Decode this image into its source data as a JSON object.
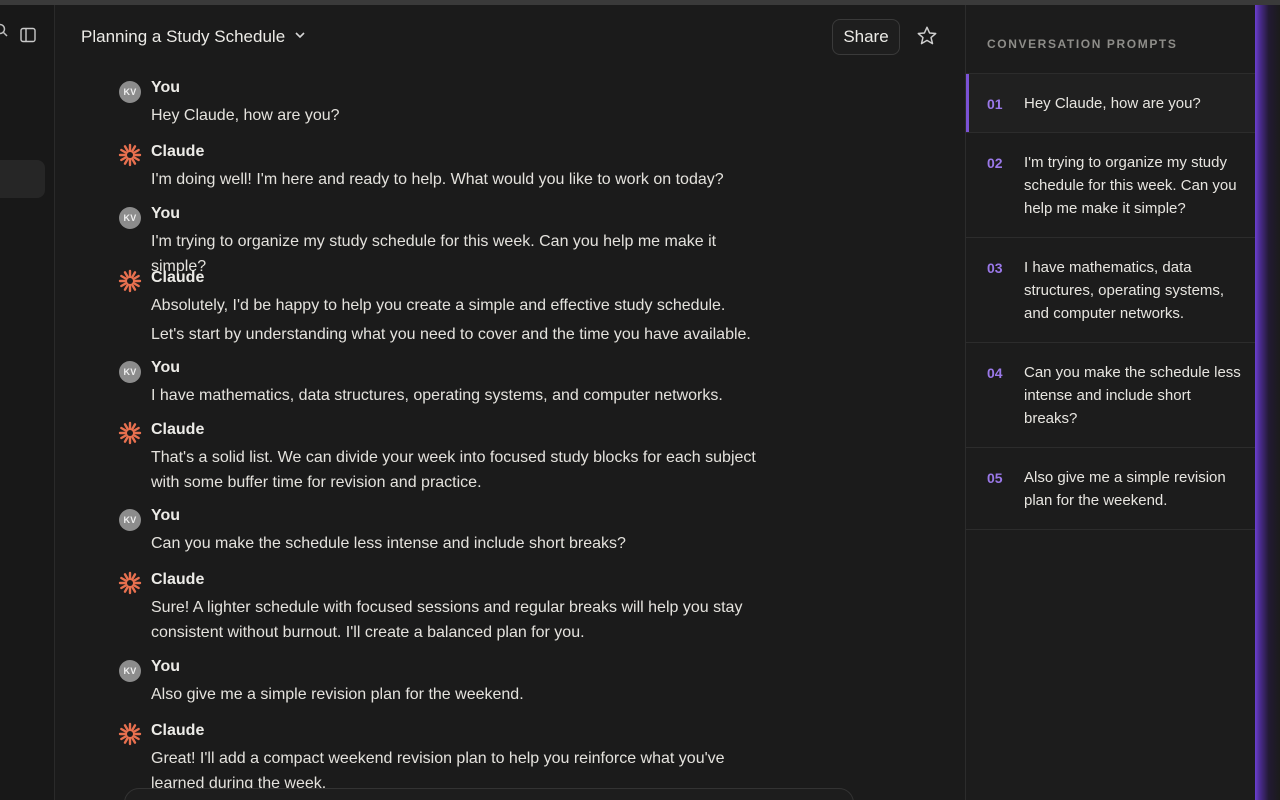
{
  "header": {
    "title": "Planning a Study Schedule",
    "share_label": "Share"
  },
  "colors": {
    "background": "#1b1b1b",
    "accent_purple": "#7b52d6",
    "claude_orange": "#e8704f",
    "avatar_gray": "#8c8c8c"
  },
  "messages": [
    {
      "sender": "You",
      "avatar": "KV",
      "text": [
        "Hey Claude, how are you?"
      ]
    },
    {
      "sender": "Claude",
      "text": [
        "I'm doing well! I'm here and ready to help. What would you like to work on today?"
      ]
    },
    {
      "sender": "You",
      "avatar": "KV",
      "text": [
        "I'm trying to organize my study schedule for this week. Can you help me make it simple?"
      ]
    },
    {
      "sender": "Claude",
      "text": [
        "Absolutely, I'd be happy to help you create a simple and effective study schedule.",
        "Let's start by understanding what you need to cover and the time you have available."
      ]
    },
    {
      "sender": "You",
      "avatar": "KV",
      "text": [
        "I have mathematics, data structures, operating systems, and computer networks."
      ]
    },
    {
      "sender": "Claude",
      "text": [
        "That's a solid list. We can divide your week into focused study blocks for each subject with some buffer time for revision and practice."
      ]
    },
    {
      "sender": "You",
      "avatar": "KV",
      "text": [
        "Can you make the schedule less intense and include short breaks?"
      ]
    },
    {
      "sender": "Claude",
      "text": [
        "Sure! A lighter schedule with focused sessions and regular breaks will help you stay consistent without burnout. I'll create a balanced plan for you."
      ]
    },
    {
      "sender": "You",
      "avatar": "KV",
      "text": [
        "Also give me a simple revision plan for the weekend."
      ]
    },
    {
      "sender": "Claude",
      "text": [
        "Great! I'll add a compact weekend revision plan to help you reinforce what you've learned during the week."
      ]
    }
  ],
  "panel": {
    "heading": "CONVERSATION PROMPTS",
    "prompts": [
      {
        "num": "01",
        "text": "Hey Claude, how are you?",
        "active": true
      },
      {
        "num": "02",
        "text": "I'm trying to organize my study schedule for this week. Can you help me make it simple?"
      },
      {
        "num": "03",
        "text": "I have mathematics, data structures, operating systems, and computer networks."
      },
      {
        "num": "04",
        "text": "Can you make the schedule less intense and include short breaks?"
      },
      {
        "num": "05",
        "text": "Also give me a simple revision plan for the weekend."
      }
    ]
  },
  "icons": {
    "rail_search": "search-icon",
    "rail_toggle": "sidebar-toggle-icon",
    "title_menu": "chevron-down-icon",
    "star": "star-icon",
    "claude": "claude-logo-icon"
  }
}
